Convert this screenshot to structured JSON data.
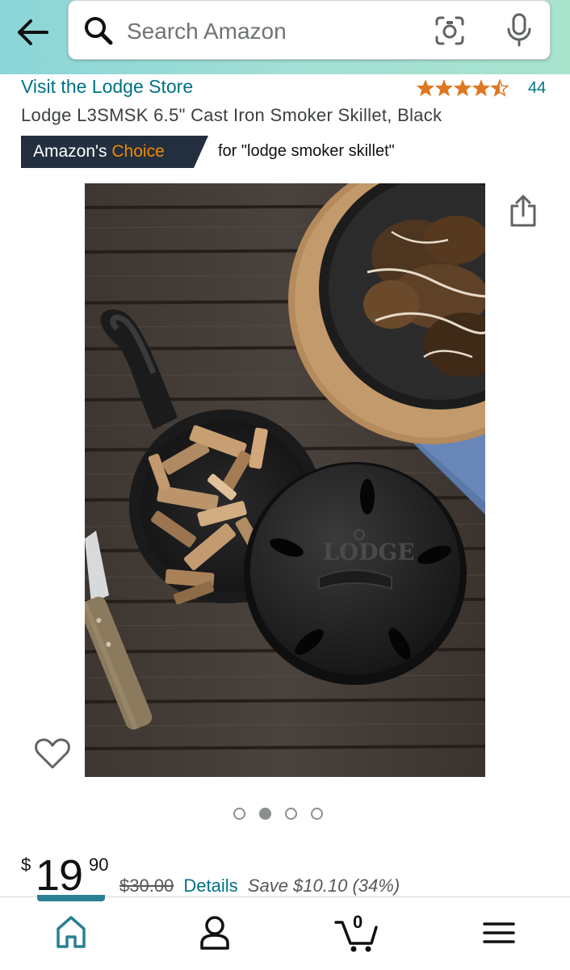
{
  "header": {
    "search_placeholder": "Search Amazon"
  },
  "product": {
    "store_link": "Visit the Lodge Store",
    "rating": 4.5,
    "rating_count": "44",
    "title": "Lodge L3SMSK 6.5\" Cast Iron Smoker Skillet, Black",
    "badge_prefix": "Amazon's",
    "badge_suffix": "Choice",
    "badge_for": "for \"lodge smoker skillet\"",
    "image_count": 4,
    "image_index": 1,
    "lid_text": "LODGE"
  },
  "price": {
    "currency": "$",
    "whole": "19",
    "fraction": "90",
    "list_price": "$30.00",
    "details_label": "Details",
    "savings": "Save $10.10 (34%)"
  },
  "bottom_nav": {
    "cart_count": "0",
    "active": "home"
  },
  "colors": {
    "link": "#007185",
    "badge_bg": "#232f3e",
    "badge_accent": "#f08804",
    "star": "#de7921",
    "nav_active": "#2a7f94"
  }
}
